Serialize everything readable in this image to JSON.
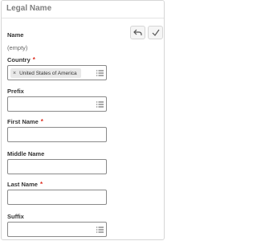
{
  "section": {
    "title": "Legal Name"
  },
  "name": {
    "label": "Name",
    "value": "(empty)"
  },
  "actions": {
    "undo_icon": "undo-arrow-icon",
    "confirm_icon": "checkmark-icon"
  },
  "fields": {
    "country": {
      "label": "Country",
      "required_marker": "*",
      "selected": "United States of America",
      "remove_icon": "×"
    },
    "prefix": {
      "label": "Prefix",
      "value": ""
    },
    "first_name": {
      "label": "First Name",
      "required_marker": "*",
      "value": ""
    },
    "middle_name": {
      "label": "Middle Name",
      "value": ""
    },
    "last_name": {
      "label": "Last Name",
      "required_marker": "*",
      "value": ""
    },
    "suffix": {
      "label": "Suffix",
      "value": ""
    }
  },
  "colors": {
    "required": "#de2e21",
    "header_text": "#7f7f7f",
    "border": "#8a8a8a"
  }
}
